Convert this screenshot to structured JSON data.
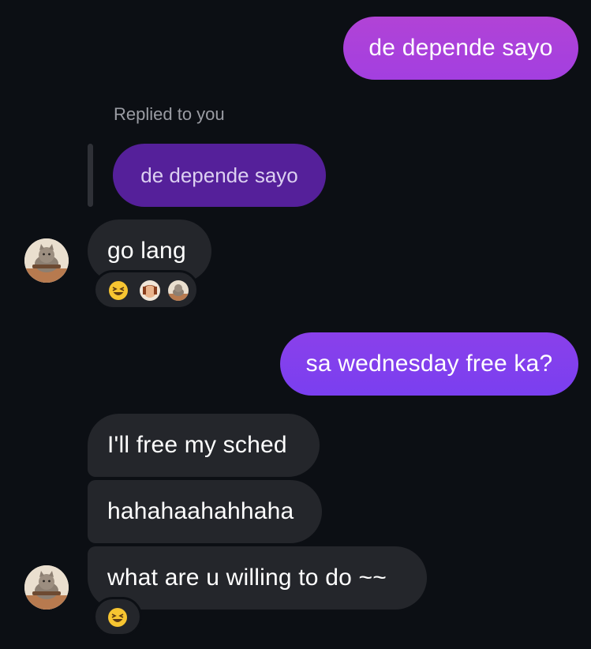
{
  "colors": {
    "background": "#0c0f14",
    "incoming_bubble": "#24262b",
    "outgoing_gradient_top": "#b143d6",
    "outgoing_gradient_bottom": "#7a3ff0",
    "reply_preview_bubble": "#55209a"
  },
  "messages": {
    "sent_1": "de depende sayo",
    "reply_label": "Replied to you",
    "reply_quote": "de depende sayo",
    "recv_1": "go lang",
    "sent_2": "sa wednesday free ka?",
    "recv_2": "I'll free my sched",
    "recv_3": "hahahaahahhaha",
    "recv_4": "what are u willing to do ~~"
  },
  "reactions": {
    "recv_1": [
      "laughing-emoji",
      "person-avatar",
      "cat-avatar"
    ],
    "recv_4": [
      "laughing-emoji"
    ]
  },
  "icons": {
    "avatar": "cat-avatar",
    "laughing": "laughing-emoji"
  }
}
